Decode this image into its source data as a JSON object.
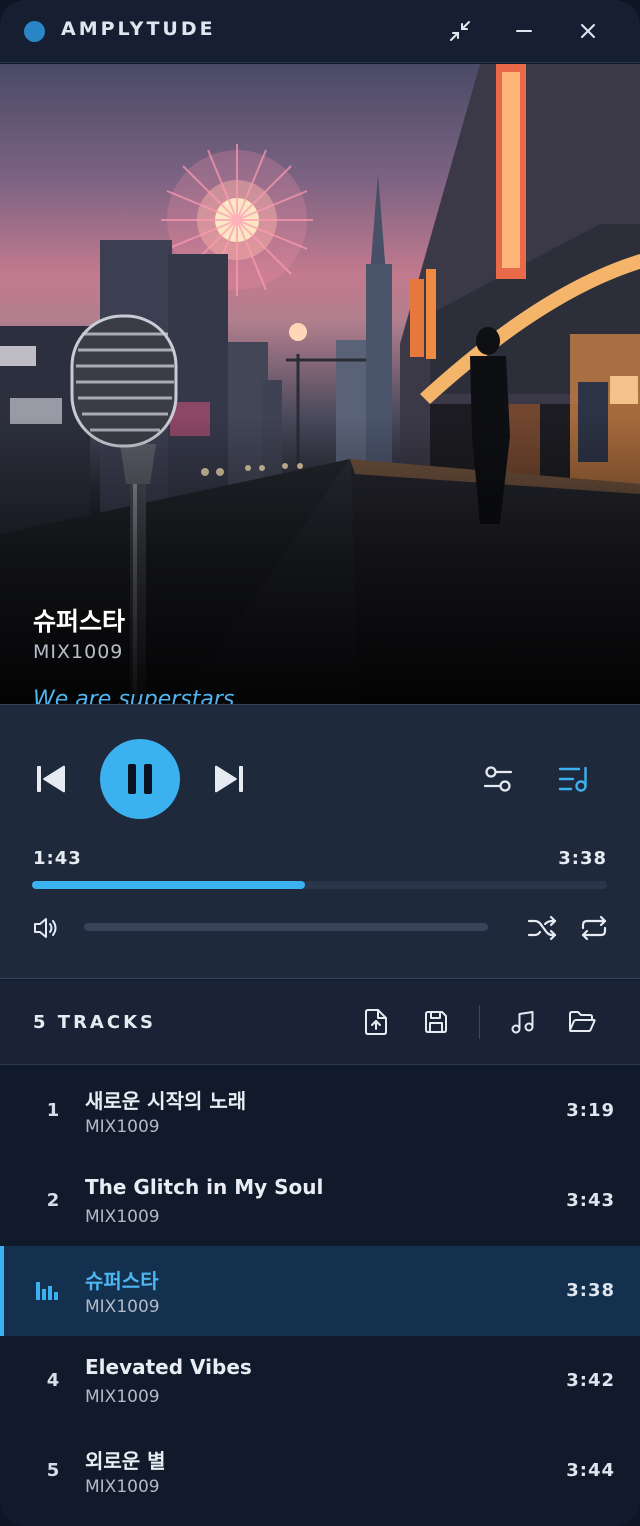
{
  "app": {
    "title": "AMPLYTUDE",
    "accent_color": "#3cb1ef",
    "icons": {
      "minimize_view": "compress-icon",
      "minimize": "minimize-icon",
      "close": "close-icon"
    }
  },
  "now_playing": {
    "title": "슈퍼스타",
    "artist": "MIX1009",
    "lyric": "We are superstars",
    "elapsed": "1:43",
    "duration": "3:38",
    "progress_fraction": 0.475
  },
  "controls": {
    "icons": [
      "skip-previous-icon",
      "pause-icon",
      "skip-next-icon",
      "equalizer-settings-icon",
      "playlist-icon",
      "volume-icon",
      "shuffle-icon",
      "repeat-icon"
    ]
  },
  "playlist": {
    "count_label": "5 TRACKS",
    "actions": [
      "export-icon",
      "save-icon",
      "add-music-icon",
      "open-folder-icon"
    ],
    "tracks": [
      {
        "number": "1",
        "title": "새로운 시작의 노래",
        "artist": "MIX1009",
        "duration": "3:19",
        "active": false
      },
      {
        "number": "2",
        "title": "The Glitch in My Soul",
        "artist": "MIX1009",
        "duration": "3:43",
        "active": false
      },
      {
        "number": "3",
        "title": "슈퍼스타",
        "artist": "MIX1009",
        "duration": "3:38",
        "active": true
      },
      {
        "number": "4",
        "title": "Elevated Vibes",
        "artist": "MIX1009",
        "duration": "3:42",
        "active": false
      },
      {
        "number": "5",
        "title": "외로운 별",
        "artist": "MIX1009",
        "duration": "3:44",
        "active": false
      }
    ]
  }
}
